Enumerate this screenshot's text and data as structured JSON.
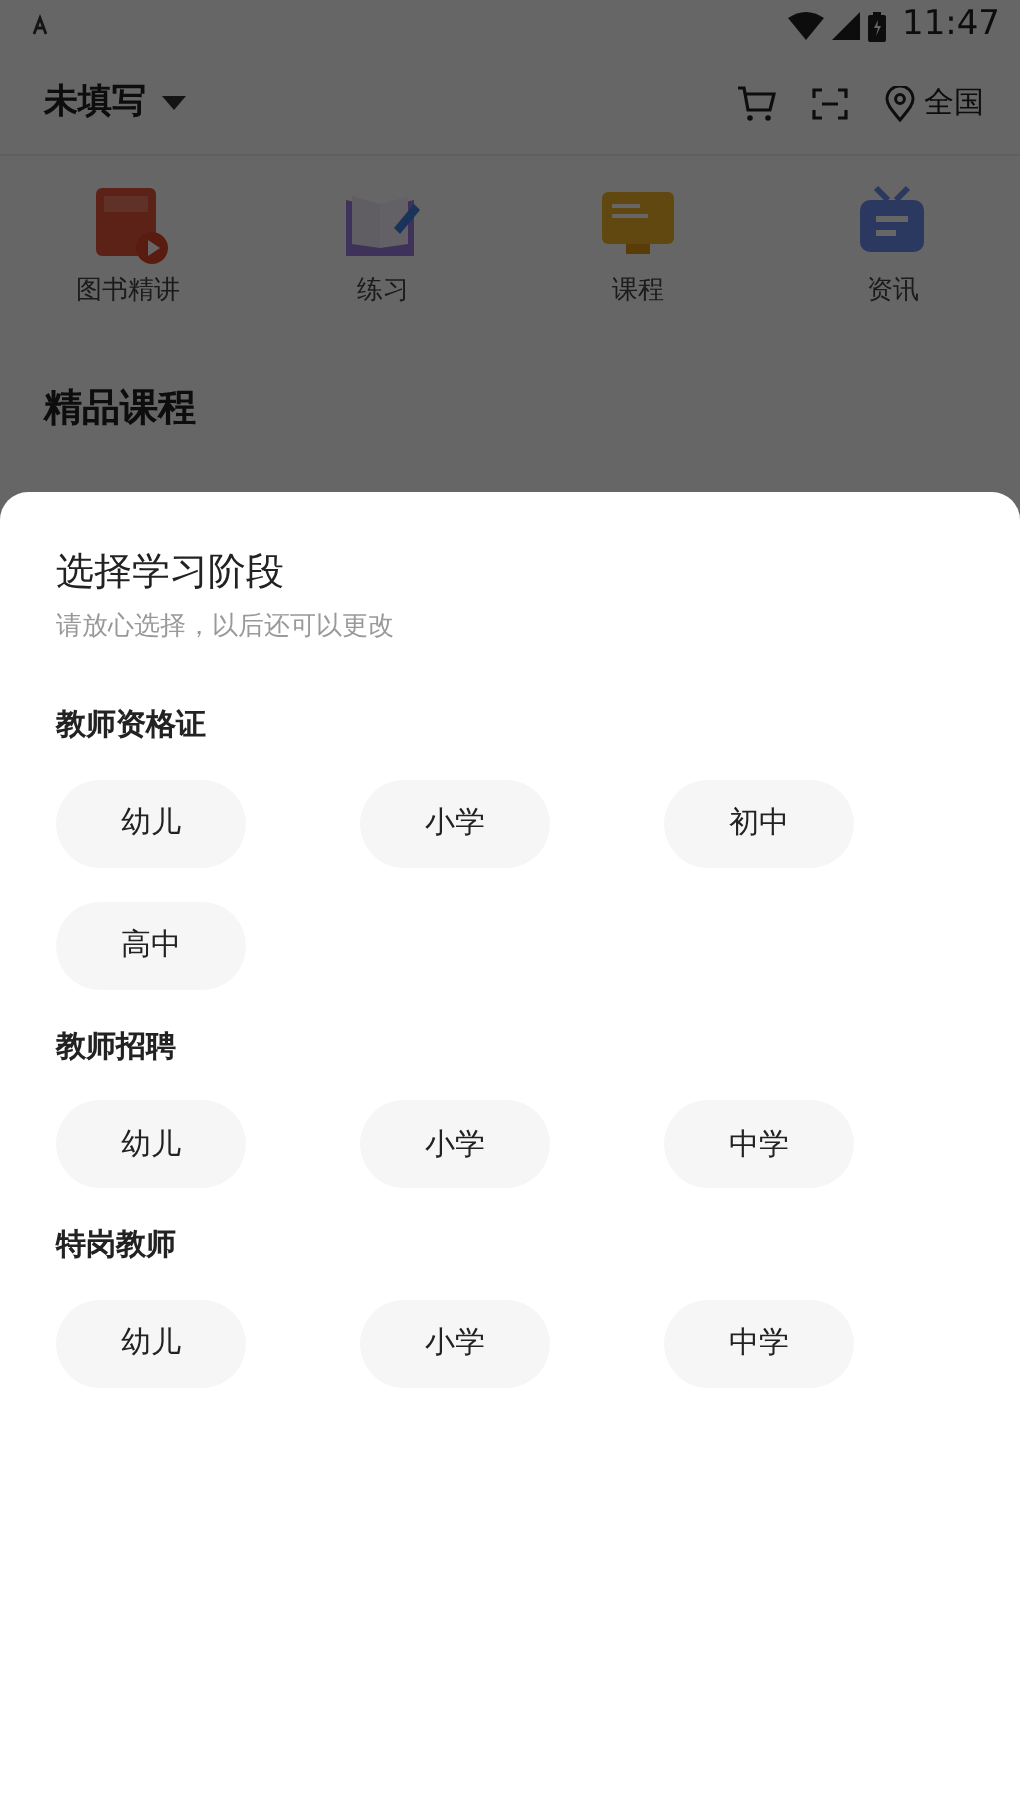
{
  "status_bar": {
    "time": "11:47"
  },
  "header": {
    "location_title": "未填写",
    "region": "全国"
  },
  "shortcuts": [
    {
      "label": "图书精讲",
      "kind": "book"
    },
    {
      "label": "练习",
      "kind": "practice"
    },
    {
      "label": "课程",
      "kind": "course"
    },
    {
      "label": "资讯",
      "kind": "news"
    }
  ],
  "section_title": "精品课程",
  "sheet": {
    "title": "选择学习阶段",
    "subtitle": "请放心选择，以后还可以更改",
    "groups": [
      {
        "title": "教师资格证",
        "options": [
          "幼儿",
          "小学",
          "初中",
          "高中"
        ]
      },
      {
        "title": "教师招聘",
        "options": [
          "幼儿",
          "小学",
          "中学"
        ]
      },
      {
        "title": "特岗教师",
        "options": [
          "幼儿",
          "小学",
          "中学"
        ]
      }
    ]
  }
}
